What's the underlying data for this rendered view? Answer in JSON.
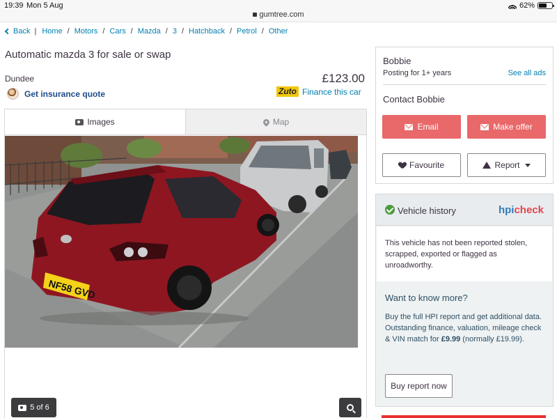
{
  "status_bar": {
    "time": "19:39",
    "date": "Mon 5 Aug",
    "url": "gumtree.com",
    "battery": "62%"
  },
  "breadcrumb": {
    "back": "Back",
    "items": [
      "Home",
      "Motors",
      "Cars",
      "Mazda",
      "3",
      "Hatchback",
      "Petrol",
      "Other"
    ]
  },
  "listing": {
    "title": "Automatic mazda 3 for sale or swap",
    "location": "Dundee",
    "price": "£123.00",
    "insurance_link": "Get insurance quote",
    "zuto_logo": "Zuto",
    "finance_link": "Finance this car"
  },
  "media": {
    "tabs": [
      "Images",
      "Map"
    ],
    "active_tab": "Images",
    "counter": "5 of 6",
    "plate": "NF58 GVD"
  },
  "seller": {
    "name": "Bobbie",
    "posting": "Posting for 1+ years",
    "see_all": "See all ads",
    "contact_title": "Contact Bobbie",
    "email_label": "Email",
    "offer_label": "Make offer",
    "favourite_label": "Favourite",
    "report_label": "Report"
  },
  "vehicle_history": {
    "title": "Vehicle history",
    "logo_a": "hpi",
    "logo_b": "check",
    "status_text": "This vehicle has not been reported stolen, scrapped, exported or flagged as unroadworthy.",
    "want_title": "Want to know more?",
    "buy_line1": "Buy the full HPI report and get additional data.",
    "buy_line2_pre": "Outstanding finance, valuation, mileage check & VIN match for ",
    "buy_price": "£9.99",
    "buy_line2_post": " (normally £19.99).",
    "buy_button": "Buy report now"
  },
  "colors": {
    "link": "#007fb0",
    "accent_red": "#e96869",
    "text": "#3c3241",
    "zuto_yellow": "#f2c70a"
  }
}
